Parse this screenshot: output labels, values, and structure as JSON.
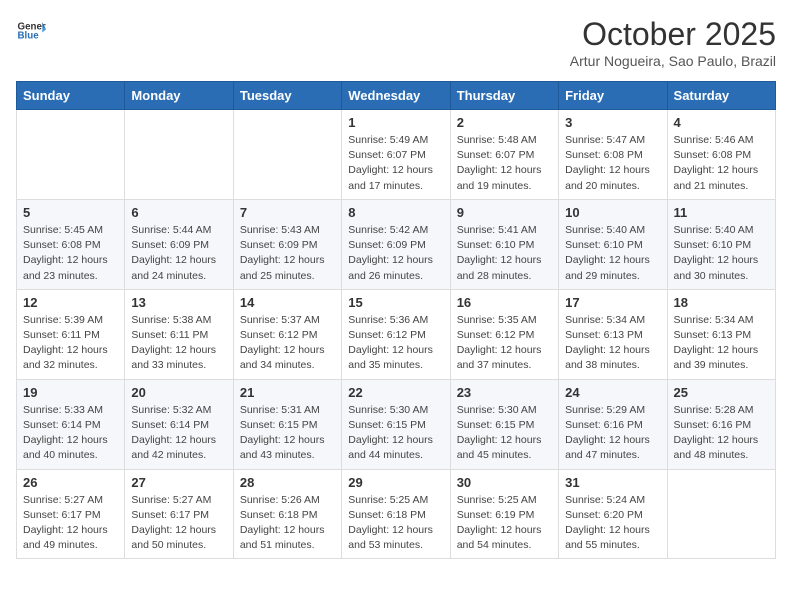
{
  "header": {
    "logo_general": "General",
    "logo_blue": "Blue",
    "title": "October 2025",
    "subtitle": "Artur Nogueira, Sao Paulo, Brazil"
  },
  "weekdays": [
    "Sunday",
    "Monday",
    "Tuesday",
    "Wednesday",
    "Thursday",
    "Friday",
    "Saturday"
  ],
  "weeks": [
    [
      {
        "day": "",
        "info": ""
      },
      {
        "day": "",
        "info": ""
      },
      {
        "day": "",
        "info": ""
      },
      {
        "day": "1",
        "info": "Sunrise: 5:49 AM\nSunset: 6:07 PM\nDaylight: 12 hours\nand 17 minutes."
      },
      {
        "day": "2",
        "info": "Sunrise: 5:48 AM\nSunset: 6:07 PM\nDaylight: 12 hours\nand 19 minutes."
      },
      {
        "day": "3",
        "info": "Sunrise: 5:47 AM\nSunset: 6:08 PM\nDaylight: 12 hours\nand 20 minutes."
      },
      {
        "day": "4",
        "info": "Sunrise: 5:46 AM\nSunset: 6:08 PM\nDaylight: 12 hours\nand 21 minutes."
      }
    ],
    [
      {
        "day": "5",
        "info": "Sunrise: 5:45 AM\nSunset: 6:08 PM\nDaylight: 12 hours\nand 23 minutes."
      },
      {
        "day": "6",
        "info": "Sunrise: 5:44 AM\nSunset: 6:09 PM\nDaylight: 12 hours\nand 24 minutes."
      },
      {
        "day": "7",
        "info": "Sunrise: 5:43 AM\nSunset: 6:09 PM\nDaylight: 12 hours\nand 25 minutes."
      },
      {
        "day": "8",
        "info": "Sunrise: 5:42 AM\nSunset: 6:09 PM\nDaylight: 12 hours\nand 26 minutes."
      },
      {
        "day": "9",
        "info": "Sunrise: 5:41 AM\nSunset: 6:10 PM\nDaylight: 12 hours\nand 28 minutes."
      },
      {
        "day": "10",
        "info": "Sunrise: 5:40 AM\nSunset: 6:10 PM\nDaylight: 12 hours\nand 29 minutes."
      },
      {
        "day": "11",
        "info": "Sunrise: 5:40 AM\nSunset: 6:10 PM\nDaylight: 12 hours\nand 30 minutes."
      }
    ],
    [
      {
        "day": "12",
        "info": "Sunrise: 5:39 AM\nSunset: 6:11 PM\nDaylight: 12 hours\nand 32 minutes."
      },
      {
        "day": "13",
        "info": "Sunrise: 5:38 AM\nSunset: 6:11 PM\nDaylight: 12 hours\nand 33 minutes."
      },
      {
        "day": "14",
        "info": "Sunrise: 5:37 AM\nSunset: 6:12 PM\nDaylight: 12 hours\nand 34 minutes."
      },
      {
        "day": "15",
        "info": "Sunrise: 5:36 AM\nSunset: 6:12 PM\nDaylight: 12 hours\nand 35 minutes."
      },
      {
        "day": "16",
        "info": "Sunrise: 5:35 AM\nSunset: 6:12 PM\nDaylight: 12 hours\nand 37 minutes."
      },
      {
        "day": "17",
        "info": "Sunrise: 5:34 AM\nSunset: 6:13 PM\nDaylight: 12 hours\nand 38 minutes."
      },
      {
        "day": "18",
        "info": "Sunrise: 5:34 AM\nSunset: 6:13 PM\nDaylight: 12 hours\nand 39 minutes."
      }
    ],
    [
      {
        "day": "19",
        "info": "Sunrise: 5:33 AM\nSunset: 6:14 PM\nDaylight: 12 hours\nand 40 minutes."
      },
      {
        "day": "20",
        "info": "Sunrise: 5:32 AM\nSunset: 6:14 PM\nDaylight: 12 hours\nand 42 minutes."
      },
      {
        "day": "21",
        "info": "Sunrise: 5:31 AM\nSunset: 6:15 PM\nDaylight: 12 hours\nand 43 minutes."
      },
      {
        "day": "22",
        "info": "Sunrise: 5:30 AM\nSunset: 6:15 PM\nDaylight: 12 hours\nand 44 minutes."
      },
      {
        "day": "23",
        "info": "Sunrise: 5:30 AM\nSunset: 6:15 PM\nDaylight: 12 hours\nand 45 minutes."
      },
      {
        "day": "24",
        "info": "Sunrise: 5:29 AM\nSunset: 6:16 PM\nDaylight: 12 hours\nand 47 minutes."
      },
      {
        "day": "25",
        "info": "Sunrise: 5:28 AM\nSunset: 6:16 PM\nDaylight: 12 hours\nand 48 minutes."
      }
    ],
    [
      {
        "day": "26",
        "info": "Sunrise: 5:27 AM\nSunset: 6:17 PM\nDaylight: 12 hours\nand 49 minutes."
      },
      {
        "day": "27",
        "info": "Sunrise: 5:27 AM\nSunset: 6:17 PM\nDaylight: 12 hours\nand 50 minutes."
      },
      {
        "day": "28",
        "info": "Sunrise: 5:26 AM\nSunset: 6:18 PM\nDaylight: 12 hours\nand 51 minutes."
      },
      {
        "day": "29",
        "info": "Sunrise: 5:25 AM\nSunset: 6:18 PM\nDaylight: 12 hours\nand 53 minutes."
      },
      {
        "day": "30",
        "info": "Sunrise: 5:25 AM\nSunset: 6:19 PM\nDaylight: 12 hours\nand 54 minutes."
      },
      {
        "day": "31",
        "info": "Sunrise: 5:24 AM\nSunset: 6:20 PM\nDaylight: 12 hours\nand 55 minutes."
      },
      {
        "day": "",
        "info": ""
      }
    ]
  ]
}
